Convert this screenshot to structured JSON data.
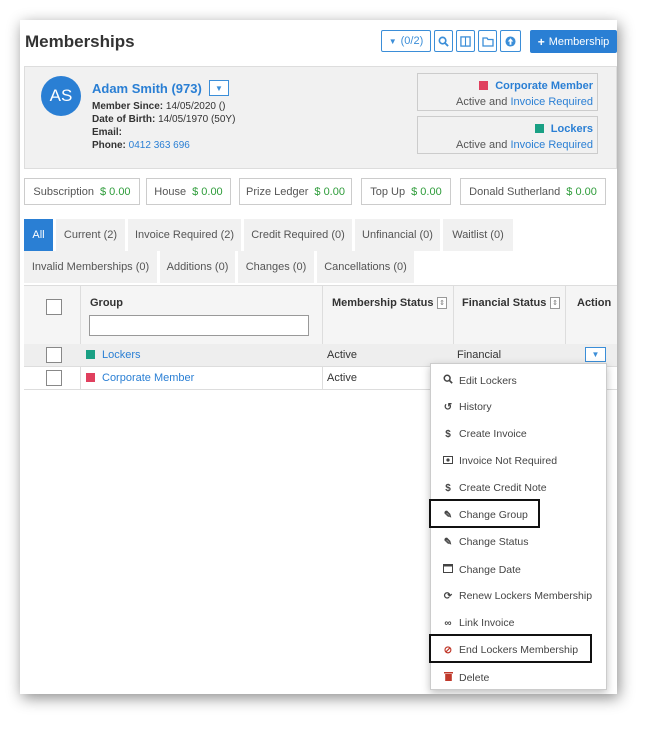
{
  "page": {
    "title": "Memberships"
  },
  "toolbar": {
    "filter_label": "(0/2)",
    "add_label": "Membership"
  },
  "member": {
    "initials": "AS",
    "name": "Adam Smith (973)",
    "since_label": "Member Since:",
    "since_value": "14/05/2020 ()",
    "dob_label": "Date of Birth:",
    "dob_value": "14/05/1970 (50Y)",
    "email_label": "Email:",
    "phone_label": "Phone:",
    "phone_value": "0412 363 696"
  },
  "cards": [
    {
      "title": "Corporate Member",
      "status_prefix": "Active and",
      "status_link": "Invoice Required",
      "color": "#e0405e"
    },
    {
      "title": "Lockers",
      "status_prefix": "Active and",
      "status_link": "Invoice Required",
      "color": "#1aa084"
    }
  ],
  "balances": [
    {
      "label": "Subscription",
      "value": "$ 0.00"
    },
    {
      "label": "House",
      "value": "$ 0.00"
    },
    {
      "label": "Prize Ledger",
      "value": "$ 0.00"
    },
    {
      "label": "Top Up",
      "value": "$ 0.00"
    },
    {
      "label": "Donald Sutherland",
      "value": "$ 0.00"
    }
  ],
  "tabs": [
    "All",
    "Current (2)",
    "Invoice Required (2)",
    "Credit Required (0)",
    "Unfinancial (0)",
    "Waitlist (0)",
    "Invalid Memberships (0)",
    "Additions (0)",
    "Changes (0)",
    "Cancellations (0)"
  ],
  "table": {
    "headers": {
      "group": "Group",
      "membership_status": "Membership Status",
      "financial_status": "Financial Status",
      "action": "Action"
    },
    "rows": [
      {
        "group": "Lockers",
        "color": "#1aa084",
        "status": "Active",
        "financial": "Financial"
      },
      {
        "group": "Corporate Member",
        "color": "#e0405e",
        "status": "Active",
        "financial": ""
      }
    ]
  },
  "menu": {
    "items": [
      {
        "label": "Edit Lockers",
        "icon": "search-icon"
      },
      {
        "label": "History",
        "icon": "history-icon"
      },
      {
        "label": "Create Invoice",
        "icon": "dollar-icon"
      },
      {
        "label": "Invoice Not Required",
        "icon": "money-icon"
      },
      {
        "label": "Create Credit Note",
        "icon": "dollar-icon"
      },
      {
        "label": "Change Group",
        "icon": "pencil-icon"
      },
      {
        "label": "Change Status",
        "icon": "pencil-icon"
      },
      {
        "label": "Change Date",
        "icon": "calendar-icon"
      },
      {
        "label": "Renew Lockers Membership",
        "icon": "refresh-icon"
      },
      {
        "label": "Link Invoice",
        "icon": "link-icon"
      },
      {
        "label": "End Lockers Membership",
        "icon": "ban-icon"
      },
      {
        "label": "Delete",
        "icon": "trash-icon"
      }
    ]
  },
  "colors": {
    "accent": "#2a7fd4",
    "money": "#2e9c3a",
    "danger": "#c0392b"
  }
}
